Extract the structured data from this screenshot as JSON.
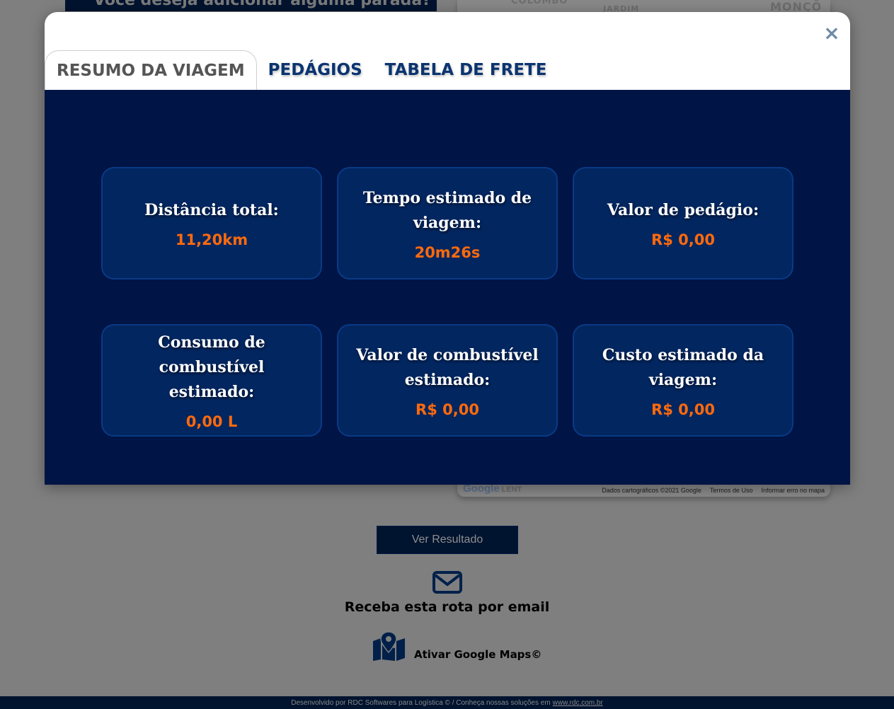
{
  "background": {
    "stop_question": "Você deseja adicionar alguma parada?",
    "map": {
      "labels": [
        "COLOMBO",
        "JARDIM",
        "MONÇÕ"
      ],
      "google_logo": "Google",
      "google_logo_suffix": "LENT",
      "footer": [
        "Dados cartográficos ©2021 Google",
        "Termos de Uso",
        "Informar erro no mapa"
      ]
    },
    "result_button": "Ver Resultado",
    "email_text": "Receba esta rota por email",
    "google_maps_text": "Ativar Google Maps©",
    "footer_text": "Desenvolvido por RDC Softwares para Logística © / Conheça nossas soluções em",
    "footer_link": "www.rdc.com.br"
  },
  "modal": {
    "close_symbol": "×",
    "tabs": [
      {
        "label": "RESUMO DA VIAGEM",
        "active": true
      },
      {
        "label": "PEDÁGIOS",
        "active": false
      },
      {
        "label": "TABELA DE FRETE",
        "active": false
      }
    ],
    "cards": [
      {
        "label": "Distância total:",
        "value": "11,20km"
      },
      {
        "label": "Tempo estimado de viagem:",
        "value": "20m26s"
      },
      {
        "label": "Valor de pedágio:",
        "value": "R$ 0,00"
      },
      {
        "label": "Consumo de combustível estimado:",
        "value": "0,00 L"
      },
      {
        "label": "Valor de combustível estimado:",
        "value": "R$ 0,00"
      },
      {
        "label": "Custo estimado da viagem:",
        "value": "R$ 0,00"
      }
    ]
  },
  "colors": {
    "panel_bg": "#001445",
    "card_bg": "#022660",
    "value_accent": "#ff6a0d",
    "tab_text": "#0b3470"
  }
}
